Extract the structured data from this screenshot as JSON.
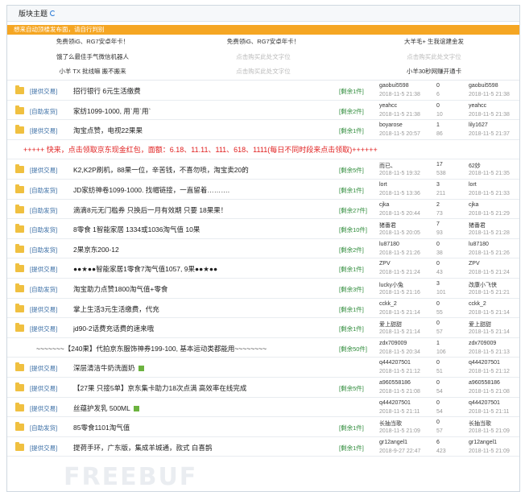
{
  "board": {
    "title": "版块主题"
  },
  "notice": "想来自动顶楼发布面，请自行判别",
  "tops": [
    {
      "text": "免费领iG、RG7安卓年卡！",
      "muted": false
    },
    {
      "text": "免费领iG、RG7安卓年卡！",
      "muted": false
    },
    {
      "text": "大羊毛+ 生我谊建金发",
      "muted": false
    },
    {
      "text": "饿了么最佳手气微信机器人",
      "muted": false
    },
    {
      "text": "点击购买此处文字位",
      "muted": true
    },
    {
      "text": "点击购买此处文字位",
      "muted": true
    },
    {
      "text": "小羊 TX 批线嘛 搬不搬来",
      "muted": false
    },
    {
      "text": "点击购买此处文字位",
      "muted": true
    },
    {
      "text": "小羊30秒网赚开通卡",
      "muted": false
    }
  ],
  "promo": "+++++ 快来，点击领取京东现金红包，面额：6.18、11.11、111、618、1111(每日不同时段来点击领取)++++++",
  "rows": [
    {
      "cat": "[提供交易]",
      "subject": "招行银行 6元生活缴费",
      "reward": "[剩余1件]",
      "author": "gaobui5598",
      "author_date": "2018-11-5 21:38",
      "replies": "0",
      "views": "6",
      "last": "gaobui5598",
      "last_date": "2018-11-5 21:38",
      "icon": false
    },
    {
      "cat": "[自助发货]",
      "subject": "家纺1099-1000, 用`用`用`",
      "reward": "[剩余2件]",
      "author": "yeahcc",
      "author_date": "2018-11-5 21:38",
      "replies": "0",
      "views": "10",
      "last": "yeahcc",
      "last_date": "2018-11-5 21:38",
      "icon": false
    },
    {
      "cat": "[提供交易]",
      "subject": "淘宝点赞，电视22果果",
      "reward": "[剩余1件]",
      "author": "boyarose",
      "author_date": "2018-11-5 20:57",
      "replies": "1",
      "views": "86",
      "last": "lily1627",
      "last_date": "2018-11-5 21:37",
      "icon": false
    },
    {
      "cat": "[提供交易]",
      "subject": "K2,K2P刷机，88果一位，辛苦钱，不喜勿喷，淘宝卖20的",
      "reward": "[剩余5件]",
      "author": "而已、",
      "author_date": "2018-11-5 19:32",
      "replies": "17",
      "views": "538",
      "last": "62妙",
      "last_date": "2018-11-5 21:35",
      "icon": false
    },
    {
      "cat": "[自助发货]",
      "subject": "JD家纺神卷1099-1000. 找帽链接，一直留着……….",
      "reward": "[剩余1件]",
      "author": "lort",
      "author_date": "2018-11-5 13:36",
      "replies": "3",
      "views": "211",
      "last": "lort",
      "last_date": "2018-11-5 21:33",
      "icon": false
    },
    {
      "cat": "[自助发货]",
      "subject": "滴滴8元无门槛券 只换后一月有效期 只要 18果果！",
      "reward": "[剩余27件]",
      "author": "cjka",
      "author_date": "2018-11-5 20:44",
      "replies": "2",
      "views": "73",
      "last": "cjka",
      "last_date": "2018-11-5 21:29",
      "icon": false
    },
    {
      "cat": "[自助发货]",
      "subject": "8零食 1智能家居 1334或1036淘气值 10果",
      "reward": "[剩余10件]",
      "author": "猪番君",
      "author_date": "2018-11-5 20:05",
      "replies": "7",
      "views": "93",
      "last": "猪番君",
      "last_date": "2018-11-5 21:28",
      "icon": false
    },
    {
      "cat": "[自助发货]",
      "subject": "2果京东200-12",
      "reward": "[剩余2件]",
      "author": "lu87180",
      "author_date": "2018-11-5 21:26",
      "replies": "0",
      "views": "38",
      "last": "lu87180",
      "last_date": "2018-11-5 21:26",
      "icon": false
    },
    {
      "cat": "[提供交易]",
      "subject": "●●★●●智能家居1零食7淘气值1057, 9果●●★●●",
      "reward": "[剩余1件]",
      "author": "ZPV",
      "author_date": "2018-11-5 21:24",
      "replies": "0",
      "views": "43",
      "last": "ZPV",
      "last_date": "2018-11-5 21:24",
      "icon": false
    },
    {
      "cat": "[自助发货]",
      "subject": "淘宝助力点赞1800淘气值+零食",
      "reward": "[剩余3件]",
      "author": "lucky小兔",
      "author_date": "2018-11-5 21:16",
      "replies": "3",
      "views": "101",
      "last": "改康小飞侠",
      "last_date": "2018-11-5 21:21",
      "icon": false
    },
    {
      "cat": "[提供交易]",
      "subject": "掌上生活3元生活缴费，代充",
      "reward": "[剩余1件]",
      "author": "cckk_2",
      "author_date": "2018-11-5 21:14",
      "replies": "0",
      "views": "55",
      "last": "cckk_2",
      "last_date": "2018-11-5 21:14",
      "icon": false
    },
    {
      "cat": "[提供交易]",
      "subject": "jd90-2话费充话费的速来哦",
      "reward": "[剩余1件]",
      "author": "爱上甜甜",
      "author_date": "2018-11-5 21:14",
      "replies": "0",
      "views": "57",
      "last": "爱上甜甜",
      "last_date": "2018-11-5 21:14",
      "icon": false
    },
    {
      "long": true,
      "subject": "~~~~~~~【240果】代拍京东服饰神券199-100, 基本运动类都能用~~~~~~~~",
      "reward": "[剩余50件]",
      "author": "zdx709009",
      "author_date": "2018-11-5 20:34",
      "replies": "1",
      "views": "106",
      "last": "zdx709009",
      "last_date": "2018-11-5 21:13",
      "icon": false
    },
    {
      "cat": "[提供交易]",
      "subject": "深层清洁牛奶洗面奶",
      "reward": "",
      "author": "q444207501",
      "author_date": "2018-11-5 21:12",
      "replies": "0",
      "views": "51",
      "last": "q444207501",
      "last_date": "2018-11-5 21:12",
      "icon": true
    },
    {
      "cat": "[提供交易]",
      "subject": "【27果 只接5单】京东集卡助力18次点满 高效率在线完成",
      "reward": "[剩余5件]",
      "author": "a960558186",
      "author_date": "2018-11-5 21:08",
      "replies": "0",
      "views": "54",
      "last": "a960558186",
      "last_date": "2018-11-5 21:08",
      "icon": false
    },
    {
      "cat": "[提供交易]",
      "subject": "丝蕴护发乳 500ML",
      "reward": "",
      "author": "q444207501",
      "author_date": "2018-11-5 21:11",
      "replies": "0",
      "views": "54",
      "last": "q444207501",
      "last_date": "2018-11-5 21:11",
      "icon": true
    },
    {
      "cat": "[自助发货]",
      "subject": "85零食1101淘气值",
      "reward": "[剩余1件]",
      "author": "长抽当歌",
      "author_date": "2018-11-5 21:09",
      "replies": "0",
      "views": "57",
      "last": "长抽当歌",
      "last_date": "2018-11-5 21:09",
      "icon": false
    },
    {
      "cat": "[提供交易]",
      "subject": "提荷手环，广东版，集成羊城通，款式 白喜鹊",
      "reward": "[剩余1件]",
      "author": "gr12angel1",
      "author_date": "2018-9-27 22:47",
      "replies": "6",
      "views": "423",
      "last": "gr12angel1",
      "last_date": "2018-11-5 21:09",
      "icon": false
    }
  ]
}
